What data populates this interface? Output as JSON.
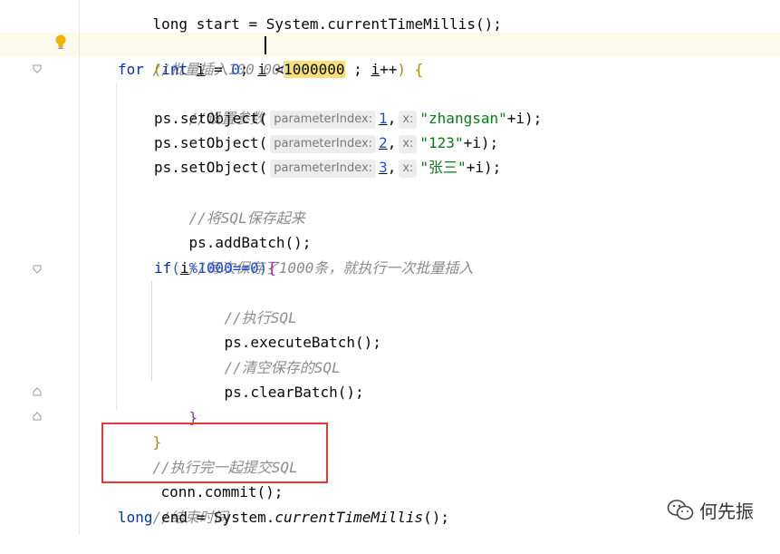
{
  "editor": {
    "line_top": "long start = System.currentTimeMillis();",
    "comment_batch_insert": "//批量插入100 0000",
    "for_loop": {
      "kw_for": "for",
      "open": "(",
      "kw_int": "int",
      "var_i": "i",
      "assign": " = ",
      "zero": "0",
      "sep1": "; ",
      "cond_lt": " <",
      "limit": "1000000",
      "sep2": " ; ",
      "incr": "++",
      "close": ")",
      "brace": "{"
    },
    "comment_set_params": "//设置参数",
    "set_calls": [
      {
        "prefix": "ps.setObject(",
        "hint_index": "parameterIndex:",
        "index": "1",
        "hint_x": "x:",
        "value": "\"zhangsan\"",
        "suffix": "+i);"
      },
      {
        "prefix": "ps.setObject(",
        "hint_index": "parameterIndex:",
        "index": "2",
        "hint_x": "x:",
        "value": "\"123\"",
        "suffix": "+i);"
      },
      {
        "prefix": "ps.setObject(",
        "hint_index": "parameterIndex:",
        "index": "3",
        "hint_x": "x:",
        "value": "\"张三\"",
        "suffix": "+i);"
      }
    ],
    "comment_save_sql": "//将SQL保存起来",
    "add_batch": "ps.addBatch();",
    "comment_every_1000": "//每次保存了1000条，就执行一次批量插入",
    "if_line": {
      "kw_if": "if",
      "expr_var": "i",
      "expr_rest": "%1000==0",
      "open": "(",
      "close": ")",
      "brace": "{"
    },
    "comment_exec_sql": "//执行SQL",
    "execute_batch": "ps.executeBatch();",
    "comment_clear_sql": "//清空保存的SQL",
    "clear_batch": "ps.clearBatch();",
    "close_brace_if": "}",
    "close_brace_for": "}",
    "comment_commit": "//执行完一起提交SQL",
    "commit": "conn.commit();",
    "comment_end_time": "//结束时间",
    "end_line": {
      "kw_long": "long",
      "rest": " end = System.",
      "method": "currentTimeMillis",
      "tail": "();"
    }
  },
  "watermark": {
    "text": "何先振",
    "icon": "wechat-icon"
  },
  "colors": {
    "keyword": "#0033b3",
    "number": "#1750eb",
    "string": "#067d17",
    "comment": "#8c8c8c",
    "highlight_box": "#e53935"
  }
}
